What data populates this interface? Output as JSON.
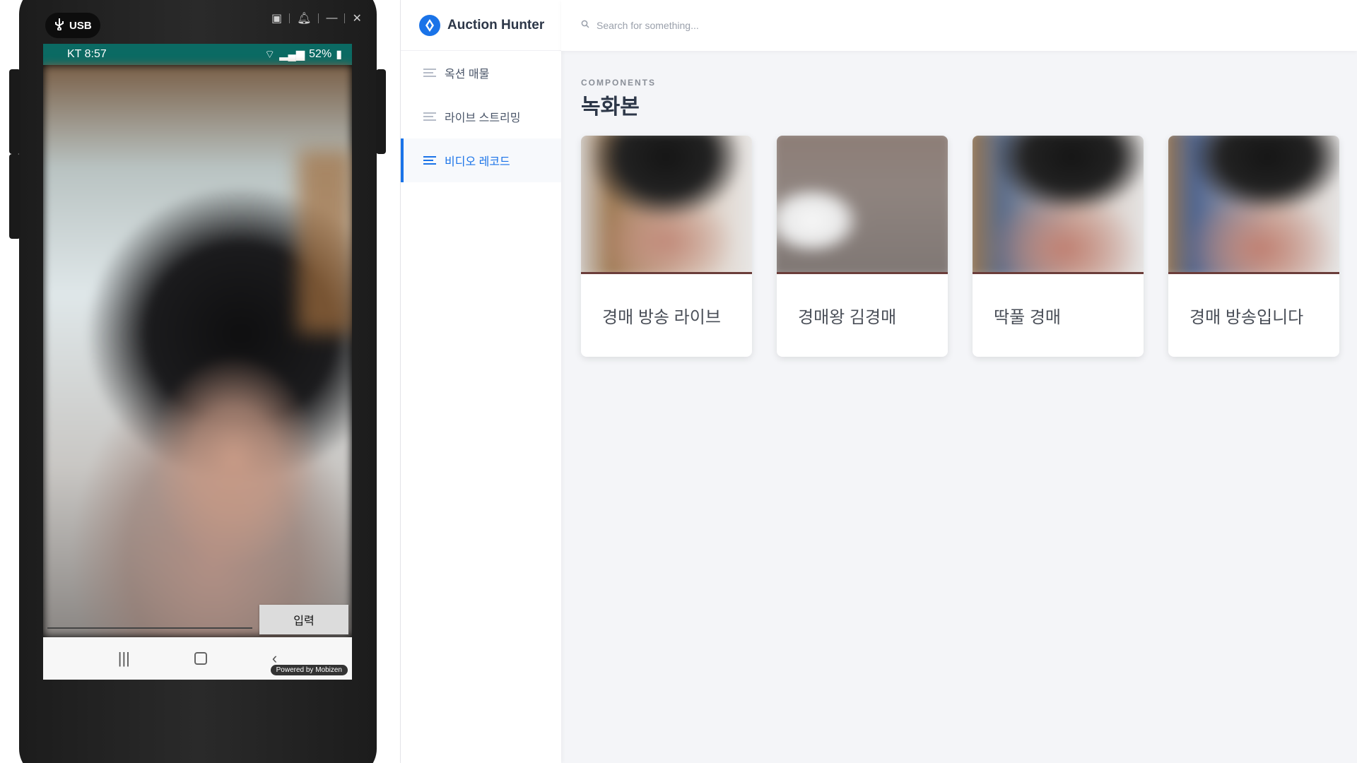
{
  "phone": {
    "usb_label": "USB",
    "status_left": "KT 8:57",
    "status_battery": "52%",
    "input_button_label": "입력",
    "powered_by": "Powered by Mobizen"
  },
  "app": {
    "brand_title": "Auction Hunter",
    "search": {
      "placeholder": "Search for something..."
    },
    "sidebar": {
      "items": [
        {
          "label": "옥션 매물",
          "active": false
        },
        {
          "label": "라이브 스트리밍",
          "active": false
        },
        {
          "label": "비디오 레코드",
          "active": true
        }
      ]
    },
    "section_eyebrow": "COMPONENTS",
    "page_title": "녹화본",
    "cards": [
      {
        "title": "경매 방송 라이브"
      },
      {
        "title": "경매왕 김경매"
      },
      {
        "title": "딱풀 경매"
      },
      {
        "title": "경매 방송입니다"
      }
    ],
    "colors": {
      "accent": "#1a73e8",
      "status_bar": "#0b6a63"
    }
  }
}
